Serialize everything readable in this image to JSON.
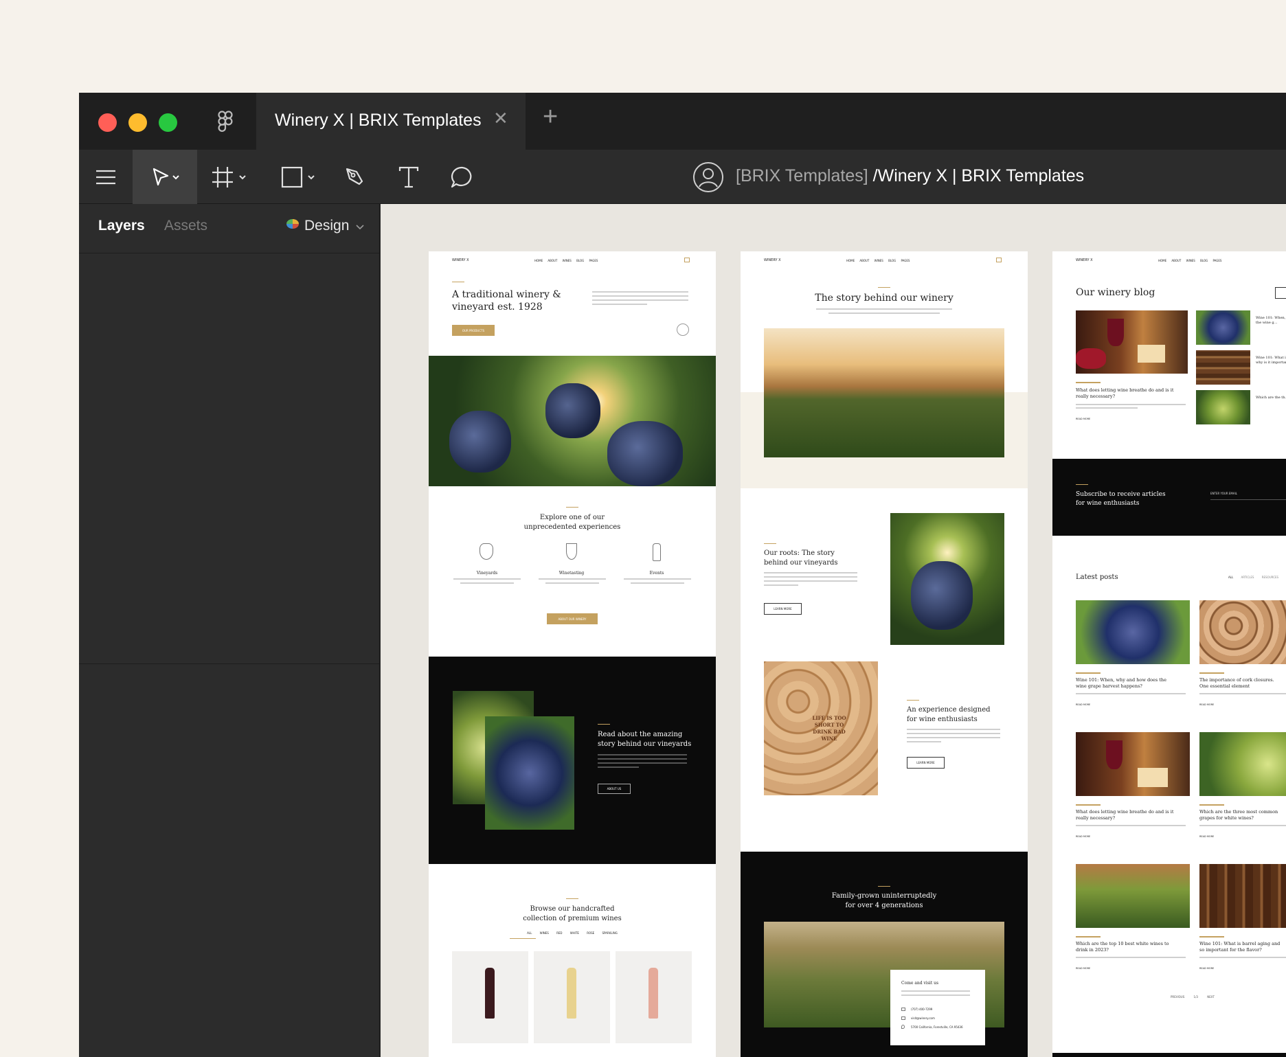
{
  "app": {
    "tab_title": "Winery X | BRIX Templates",
    "tab_close": "✕",
    "tab_add": "+",
    "breadcrumb_team": "[BRIX Templates]",
    "breadcrumb_sep": " /",
    "breadcrumb_file": "Winery X | BRIX Templates",
    "colors": {
      "close": "#ff5f57",
      "minimize": "#febc2e",
      "maximize": "#28c840",
      "accent": "#c4a15f"
    }
  },
  "toolbar": {
    "icons": [
      "menu-icon",
      "move-icon",
      "frame-icon",
      "shape-icon",
      "pen-icon",
      "text-icon",
      "comment-icon"
    ]
  },
  "panel": {
    "layers": "Layers",
    "assets": "Assets",
    "design": "Design"
  },
  "home": {
    "logo": "WINERY X",
    "nav": [
      "HOME",
      "ABOUT",
      "WINES",
      "BLOG",
      "PAGES"
    ],
    "hero_title_1": "A traditional winery &",
    "hero_title_2": "vineyard est. 1928",
    "hero_btn": "OUR PRODUCTS",
    "explore_1": "Explore one of our",
    "explore_2": "unprecedented experiences",
    "features": [
      "Vineyards",
      "Winetasting",
      "Events"
    ],
    "about_btn": "ABOUT OUR WINERY",
    "story_1": "Read about the amazing",
    "story_2": "story behind our vineyards",
    "about_us": "ABOUT US",
    "browse_1": "Browse our handcrafted",
    "browse_2": "collection of premium wines",
    "filters": [
      "ALL WINES",
      "RED",
      "WHITE",
      "ROSE",
      "SPARKLING"
    ]
  },
  "about": {
    "title": "The story behind our winery",
    "roots_1": "Our roots: The story",
    "roots_2": "behind our vineyards",
    "learn": "LEARN MORE",
    "exp_1": "An experience designed",
    "exp_2": "for wine enthusiasts",
    "cork_1": "LIFE IS TOO",
    "cork_2": "SHORT TO",
    "cork_3": "DRINK BAD",
    "cork_4": "WINE",
    "family_1": "Family-grown uninterruptedly",
    "family_2": "for over 4 generations",
    "visit": "Come and visit us",
    "phone": "(707) 400-7299",
    "email": "visit@winery.com",
    "address": "5700 California, Forestville, CA 95436"
  },
  "blog": {
    "title": "Our winery blog",
    "featured": "What does letting wine breathe do and is it really necessary?",
    "side": [
      "Wine 101: When, why and how does the wine g...",
      "Wine 101: What is barrel aging and why is it important for t...",
      "Which are the th... white wines fo..."
    ],
    "read_more": "READ MORE",
    "subscribe_1": "Subscribe to receive articles",
    "subscribe_2": "for wine enthusiasts",
    "enter_email": "ENTER YOUR EMAIL",
    "latest": "Latest posts",
    "cats": [
      "ALL",
      "ARTICLES",
      "RESOURCES"
    ],
    "posts": [
      {
        "t1": "Wine 101: When, why and how does the",
        "t2": "wine grape harvest happens?"
      },
      {
        "t1": "The importance of cork closures.",
        "t2": "One essential element"
      },
      {
        "t1": "What does letting wine breathe do and is it",
        "t2": "really necessary?"
      },
      {
        "t1": "Which are the three most common",
        "t2": "grapes for white wines?"
      },
      {
        "t1": "Which are the top 10 best white wines to",
        "t2": "drink in 2023?"
      },
      {
        "t1": "Wine 101: What is barrel aging and",
        "t2": "so important for the flavor?"
      }
    ],
    "prev": "PREVIOUS",
    "page": "1/3",
    "next": "NEXT"
  }
}
